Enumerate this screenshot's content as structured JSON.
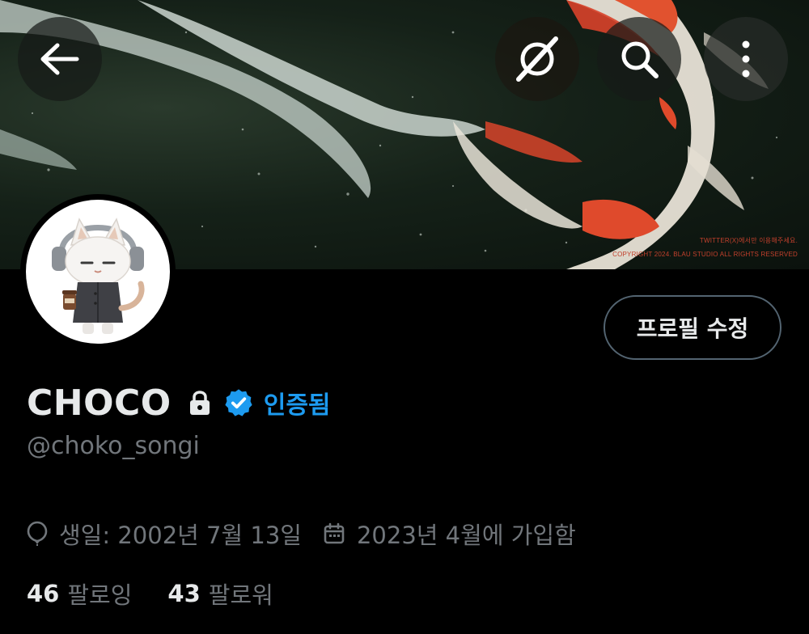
{
  "banner": {
    "copyright_line1": "TWITTER(X)에서만 이용해주세요.",
    "copyright_line2": "COPYRIGHT 2024. BLAU STUDIO ALL RIGHTS RESERVED"
  },
  "nav": {
    "back_icon": "arrow-left-icon",
    "grok_icon": "grok-icon",
    "search_icon": "search-icon",
    "more_icon": "more-vertical-icon"
  },
  "profile": {
    "display_name": "CHOCO",
    "verified_label": "인증됨",
    "handle": "@choko_songi",
    "edit_button": "프로필 수정",
    "birthday": "생일: 2002년 7월 13일",
    "joined": "2023년 4월에 가입함",
    "following_count": "46",
    "following_label": "팔로잉",
    "followers_count": "43",
    "followers_label": "팔로워"
  },
  "colors": {
    "background": "#000000",
    "primary_text": "#e7e9ea",
    "secondary_text": "#71767b",
    "accent": "#1d9bf0",
    "border": "#536471"
  }
}
